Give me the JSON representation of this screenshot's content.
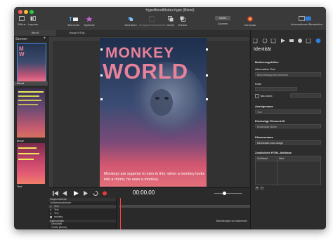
{
  "window": {
    "title": "HypeBlendModes.hype (Blend)"
  },
  "toolbar": {
    "left": [
      "Bühne",
      "Layouts"
    ],
    "center_left": [
      "Elemente",
      "Symbole"
    ],
    "center": [
      "Anordnen",
      "Gruppieren/Aufheben",
      "Vorne",
      "Zurück"
    ],
    "zoom": {
      "value": "100%",
      "label": "Zoomen"
    },
    "vorschau": "Vorschau",
    "right": "Informationen/Bearbeiten"
  },
  "tabs": {
    "blend": "Blend",
    "html": "Haupt-HTML"
  },
  "scenes": {
    "header": "Szenen",
    "items": [
      "Blend",
      "Mode",
      "Text"
    ]
  },
  "stage": {
    "headline1": "MONKEY",
    "headline2": "WORLD",
    "caption": "Monkeys are superior to men in this: when a monkey looks into a mirror, he sees a monkey."
  },
  "timeline": {
    "time": "00:00,00"
  },
  "layers": {
    "header": "Hauptzeitachse",
    "rows": [
      "Zeitachsenaktionen",
      "Text",
      "Text",
      "Text",
      "monkey"
    ],
    "props_header": "Eigenschaften",
    "props": [
      "Deckkraft",
      "Größe (Breite)"
    ],
    "status": "Beschleunigen und Abbremsen"
  },
  "inspector": {
    "title": "Identität",
    "sections": [
      {
        "label": "Bedienungshilfen"
      },
      {
        "label": "Alternativer Text",
        "placeholder": "Beschreibung des Elements"
      },
      {
        "label": "Rolle"
      },
      {
        "label": "Tab-Index"
      },
      {
        "label": "Anzeigename",
        "value": "Text"
      },
      {
        "label": "Eindeutige Element-ID",
        "value": "Eindeutiger Name"
      },
      {
        "label": "Klassenname",
        "value": "blendmode-color-dodge"
      },
      {
        "label": "Zusätzliche HTML-Attribute"
      }
    ],
    "attr_table": {
      "col1": "Schlüssel",
      "col2": "Wert"
    }
  },
  "colors": {
    "accent": "#2f7fdc",
    "headline": "#e8829a",
    "panel": "#2b2b2b"
  }
}
